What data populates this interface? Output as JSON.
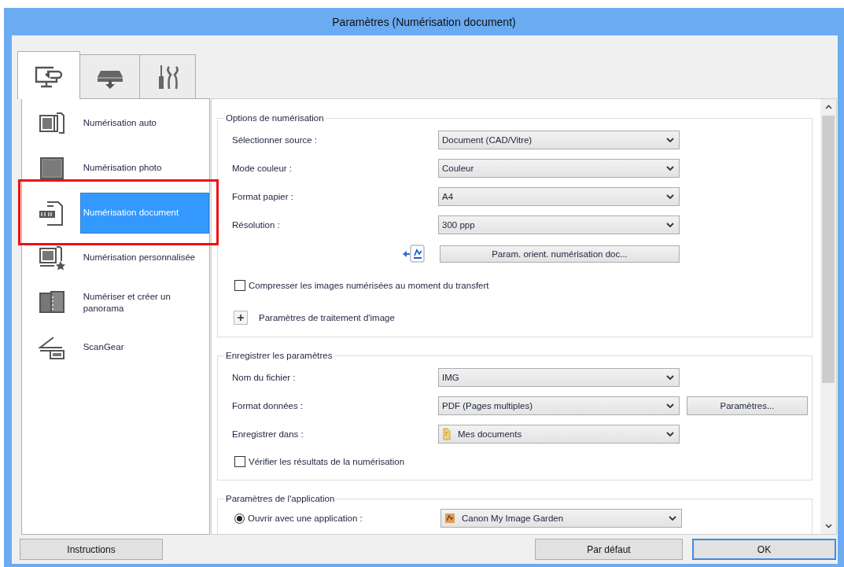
{
  "window": {
    "title": "Paramètres (Numérisation document)"
  },
  "tabs": [
    {
      "selected": true
    },
    {
      "selected": false
    },
    {
      "selected": false
    }
  ],
  "sidebar": {
    "items": [
      {
        "label": "Numérisation auto",
        "selected": false,
        "highlighted": false
      },
      {
        "label": "Numérisation photo",
        "selected": false,
        "highlighted": false
      },
      {
        "label": "Numérisation document",
        "selected": true,
        "highlighted": true
      },
      {
        "label": "Numérisation personnalisée",
        "selected": false,
        "highlighted": false
      },
      {
        "label": "Numériser et créer un panorama",
        "selected": false,
        "highlighted": false
      },
      {
        "label": "ScanGear",
        "selected": false,
        "highlighted": false
      }
    ]
  },
  "sections": [
    {
      "title": "Options de numérisation",
      "rows": [
        {
          "kind": "select",
          "label": "Sélectionner source :",
          "value": "Document (CAD/Vitre)"
        },
        {
          "kind": "select",
          "label": "Mode couleur :",
          "value": "Couleur"
        },
        {
          "kind": "select",
          "label": "Format papier :",
          "value": "A4"
        },
        {
          "kind": "select",
          "label": "Résolution :",
          "value": "300 ppp"
        },
        {
          "kind": "button",
          "button": "Param. orient. numérisation doc..."
        },
        {
          "kind": "checkbox",
          "label": "Compresser les images numérisées au moment du transfert",
          "checked": false
        },
        {
          "kind": "expander",
          "label": "Paramètres de traitement d'image",
          "expanded": false
        }
      ]
    },
    {
      "title": "Enregistrer les paramètres",
      "rows": [
        {
          "kind": "select",
          "label": "Nom du fichier :",
          "value": "IMG"
        },
        {
          "kind": "select",
          "label": "Format données :",
          "value": "PDF (Pages multiples)",
          "button": "Paramètres..."
        },
        {
          "kind": "folder-select",
          "label": "Enregistrer dans :",
          "value": "Mes documents"
        },
        {
          "kind": "checkbox",
          "label": "Vérifier les résultats de la numérisation",
          "checked": false
        }
      ]
    },
    {
      "title": "Paramètres de l'application",
      "rows": [
        {
          "kind": "radio",
          "label": "Ouvrir avec une application :",
          "selected": true,
          "value": "Canon My Image Garden"
        }
      ]
    }
  ],
  "buttons": [
    {
      "label": "Instructions",
      "default": false
    },
    {
      "label": "Par défaut",
      "default": false
    },
    {
      "label": "OK",
      "default": true
    }
  ]
}
